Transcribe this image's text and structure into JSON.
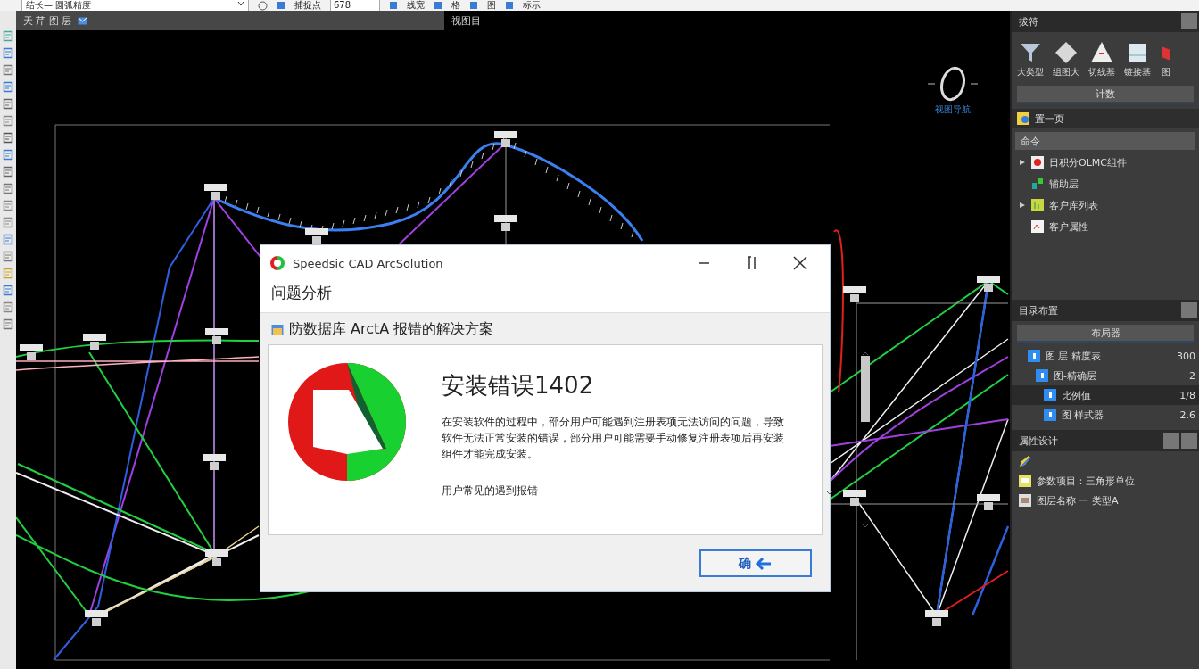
{
  "toolbar": [
    {
      "kind": "dropdown",
      "label": "结长— 圆弧精度"
    },
    {
      "kind": "button",
      "label": "捕捉点"
    },
    {
      "kind": "field",
      "label": "678"
    },
    {
      "kind": "button",
      "label": "线宽"
    },
    {
      "kind": "button",
      "label": "格"
    },
    {
      "kind": "button",
      "label": "图"
    },
    {
      "kind": "button",
      "label": "标示"
    }
  ],
  "doc_tabs": [
    {
      "label": "天 芹 图 层",
      "selected": true
    },
    {
      "label": "视图目",
      "selected": false
    }
  ],
  "canvas": {
    "view_label": "视图导航"
  },
  "dialog": {
    "title": "Speedsic CAD ArcSolution",
    "header": "问题分析",
    "subtitle": "防数据库 ArctA 报错的解决方案",
    "error_title": "安装错误1402",
    "message": "在安装软件的过程中，部分用户可能遇到注册表项无法访问的问题，导致软件无法正常安装的错误，部分用户可能需要手动修复注册表项后再安装组件才能完成安装。",
    "hint": "用户常见的遇到报错",
    "button": "确"
  },
  "tools_panel": {
    "title": "拔符",
    "tools": [
      "大类型",
      "组图大",
      "切线基",
      "链接基",
      "图"
    ],
    "count_button": "计数",
    "page_row": "置一页",
    "section": "命令",
    "items": [
      {
        "kind": "group",
        "label": "日积分OLMC组件"
      },
      {
        "kind": "item",
        "label": "辅助层"
      },
      {
        "kind": "group",
        "label": "客户库列表"
      },
      {
        "kind": "item",
        "label": "客户属性"
      }
    ]
  },
  "layout_panel": {
    "title": "目录布置",
    "bar_button": "布局器",
    "rows": [
      {
        "label": "图 层 精度表",
        "value": "300",
        "selected": false,
        "children": [
          {
            "label": "图-精确层",
            "value": "2",
            "selected": false,
            "children": [
              {
                "label": "比例值",
                "value": "1/8",
                "selected": true
              },
              {
                "label": "图 样式器",
                "value": "2.6",
                "selected": false
              }
            ]
          }
        ]
      }
    ]
  },
  "properties_panel": {
    "title": "属性设计",
    "items": [
      "参数项目：三角形单位",
      "图层名称 一 类型A"
    ]
  }
}
